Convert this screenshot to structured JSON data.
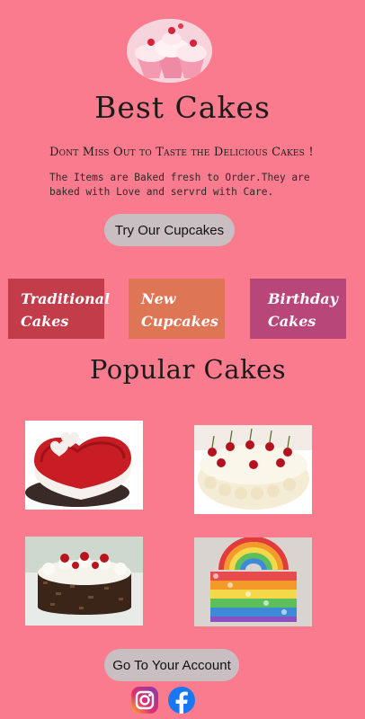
{
  "header": {
    "logo_icon": "cupcakes-logo",
    "title": "Best Cakes"
  },
  "intro": {
    "tagline": "Dont Miss Out to Taste the Delicious Cakes !",
    "description": "The Items are Baked fresh to Order.They are baked with Love and servrd with Care."
  },
  "cta": {
    "cupcakes_label": "Try Our Cupcakes",
    "account_label": "Go To Your Account"
  },
  "categories": [
    {
      "line1": "Traditional",
      "line2": "Cakes",
      "color": "#c33c4a"
    },
    {
      "line1": "New",
      "line2": "Cupcakes",
      "color": "#de7656"
    },
    {
      "line1": "Birthday",
      "line2": "Cakes",
      "color": "#b84679"
    }
  ],
  "popular": {
    "heading": "Popular Cakes",
    "items": [
      {
        "icon": "red-velvet-heart-cake"
      },
      {
        "icon": "cherry-cream-cake"
      },
      {
        "icon": "black-forest-cake"
      },
      {
        "icon": "rainbow-cake"
      }
    ]
  },
  "social": {
    "instagram_icon": "instagram-icon",
    "facebook_icon": "facebook-icon"
  },
  "colors": {
    "background": "#fb7b8e",
    "button": "#c9bfc2"
  }
}
